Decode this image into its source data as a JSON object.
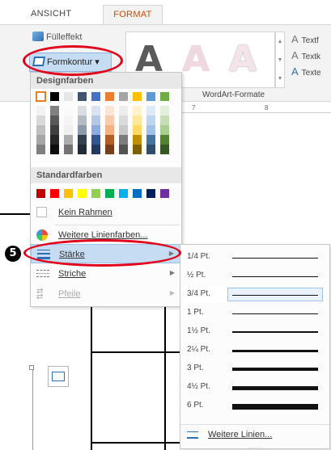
{
  "tabs": {
    "ansicht": "ANSICHT",
    "format": "FORMAT"
  },
  "ribbon": {
    "fuelleffekt": "Fülleffekt",
    "formkontur": "Formkontur",
    "wordart_sample": "A",
    "wordart_group_label": "WordArt-Formate",
    "text_items": [
      "Textf",
      "Textk",
      "Texte"
    ],
    "ruler": [
      "7",
      "8"
    ]
  },
  "menu": {
    "designfarben": "Designfarben",
    "standardfarben": "Standardfarben",
    "kein_rahmen": "Kein Rahmen",
    "weitere_linienfarben": "Weitere Linienfarben...",
    "staerke": "Stärke",
    "striche": "Striche",
    "pfeile": "Pfeile"
  },
  "theme_colors": [
    "#ffffff",
    "#000000",
    "#e7e6e6",
    "#44546a",
    "#4472c4",
    "#ed7d31",
    "#a5a5a5",
    "#ffc000",
    "#5b9bd5",
    "#70ad47"
  ],
  "standard_colors": [
    "#c00000",
    "#ff0000",
    "#ffc000",
    "#ffff00",
    "#92d050",
    "#00b050",
    "#00b0f0",
    "#0070c0",
    "#002060",
    "#7030a0"
  ],
  "submenu": {
    "weights": [
      {
        "label": "1/4 Pt.",
        "pt": 0.25
      },
      {
        "label": "½ Pt.",
        "pt": 0.5
      },
      {
        "label": "3/4 Pt.",
        "pt": 0.75,
        "selected": true
      },
      {
        "label": "1 Pt.",
        "pt": 1
      },
      {
        "label": "1½ Pt.",
        "pt": 1.5
      },
      {
        "label": "2¼ Pt.",
        "pt": 2.25
      },
      {
        "label": "3 Pt.",
        "pt": 3
      },
      {
        "label": "4½ Pt.",
        "pt": 4.5
      },
      {
        "label": "6 Pt.",
        "pt": 6
      }
    ],
    "weitere_linien": "Weitere Linien..."
  },
  "step_number": "5"
}
